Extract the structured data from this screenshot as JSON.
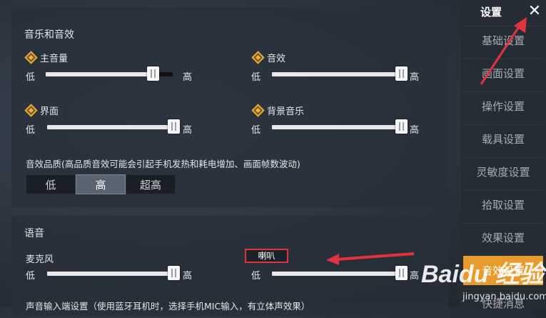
{
  "audio_section": {
    "title": "音乐和音效",
    "sliders": [
      {
        "label": "主音量",
        "low": "低",
        "high": "高",
        "value_percent": 84
      },
      {
        "label": "音效",
        "low": "低",
        "high": "高",
        "value_percent": 100
      },
      {
        "label": "界面",
        "low": "低",
        "high": "高",
        "value_percent": 100
      },
      {
        "label": "背景音乐",
        "low": "低",
        "high": "高",
        "value_percent": 100
      }
    ],
    "quality_title": "音效品质(高品质音效可能会引起手机发热和耗电增加、画面帧数波动)",
    "quality_options": [
      "低",
      "高",
      "超高"
    ],
    "quality_selected": "高"
  },
  "voice_section": {
    "title": "语音",
    "mic_label": "麦克风",
    "mic_low": "低",
    "mic_high": "高",
    "mic_value_percent": 100,
    "speaker_label": "喇叭",
    "speaker_low": "低",
    "speaker_high": "高",
    "speaker_value_percent": 100,
    "input_note": "声音输入端设置（使用蓝牙耳机时，选择手机MIC输入，有立体声效果）"
  },
  "sidebar": {
    "title": "设置",
    "close_icon": "close-icon",
    "items": [
      {
        "label": "基础设置"
      },
      {
        "label": "画面设置"
      },
      {
        "label": "操作设置"
      },
      {
        "label": "载具设置"
      },
      {
        "label": "灵敏度设置"
      },
      {
        "label": "拾取设置"
      },
      {
        "label": "效果设置"
      },
      {
        "label": "音效设置"
      },
      {
        "label": "快捷消息"
      }
    ],
    "active_index": 7
  },
  "watermark": {
    "brand": "Baidu 经验",
    "url": "jingyan.baidu.com"
  },
  "colors": {
    "accent": "#e89a2c",
    "annotation_red": "#e0333d",
    "diamond": "#f0b445"
  }
}
